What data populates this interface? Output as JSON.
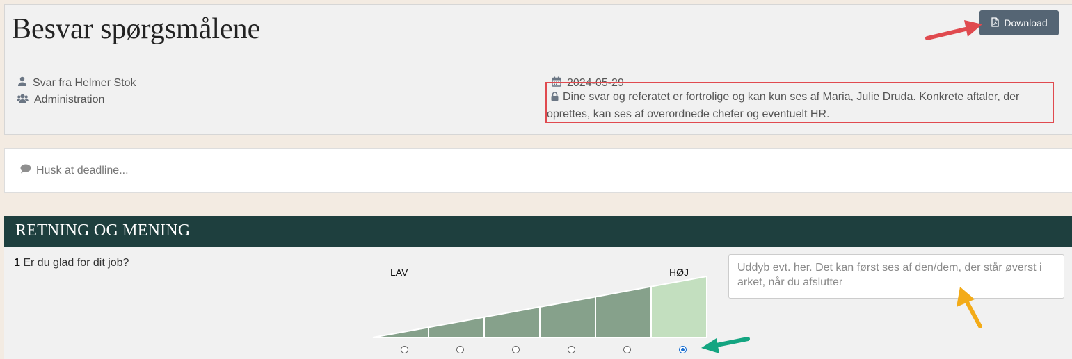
{
  "header": {
    "title": "Besvar spørgsmålene",
    "download_label": "Download",
    "respondent": "Svar fra Helmer Stok",
    "department": "Administration",
    "date": "2024-05-29",
    "privacy_notice": "Dine svar og referatet er fortrolige og kan kun ses af Maria, Julie Druda. Konkrete aftaler, der oprettes, kan ses af overordnede chefer og eventuelt HR."
  },
  "note": {
    "text": "Husk at deadline..."
  },
  "section": {
    "title": "RETNING OG MENING",
    "question_number": "1",
    "question_text": "Er du glad for dit job?",
    "scale_low_label": "LAV",
    "scale_high_label": "HØJ",
    "scale_steps": 6,
    "selected_step": 6,
    "comment_placeholder": "Uddyb evt. her. Det kan først ses af den/dem, der står øverst i arket, når du afslutter"
  },
  "colors": {
    "header_bg": "#1e3f3e",
    "bar": "#86a18b",
    "bar_selected": "#c3dfbf",
    "download_btn": "#556574",
    "annotation_red": "#e04a4f",
    "annotation_orange": "#f3ab18",
    "annotation_teal": "#14a581"
  },
  "icons": {
    "download": "file-pdf-icon",
    "respondent": "user-icon",
    "department": "users-icon",
    "date": "calendar-icon",
    "privacy": "lock-icon",
    "note": "comment-icon"
  }
}
